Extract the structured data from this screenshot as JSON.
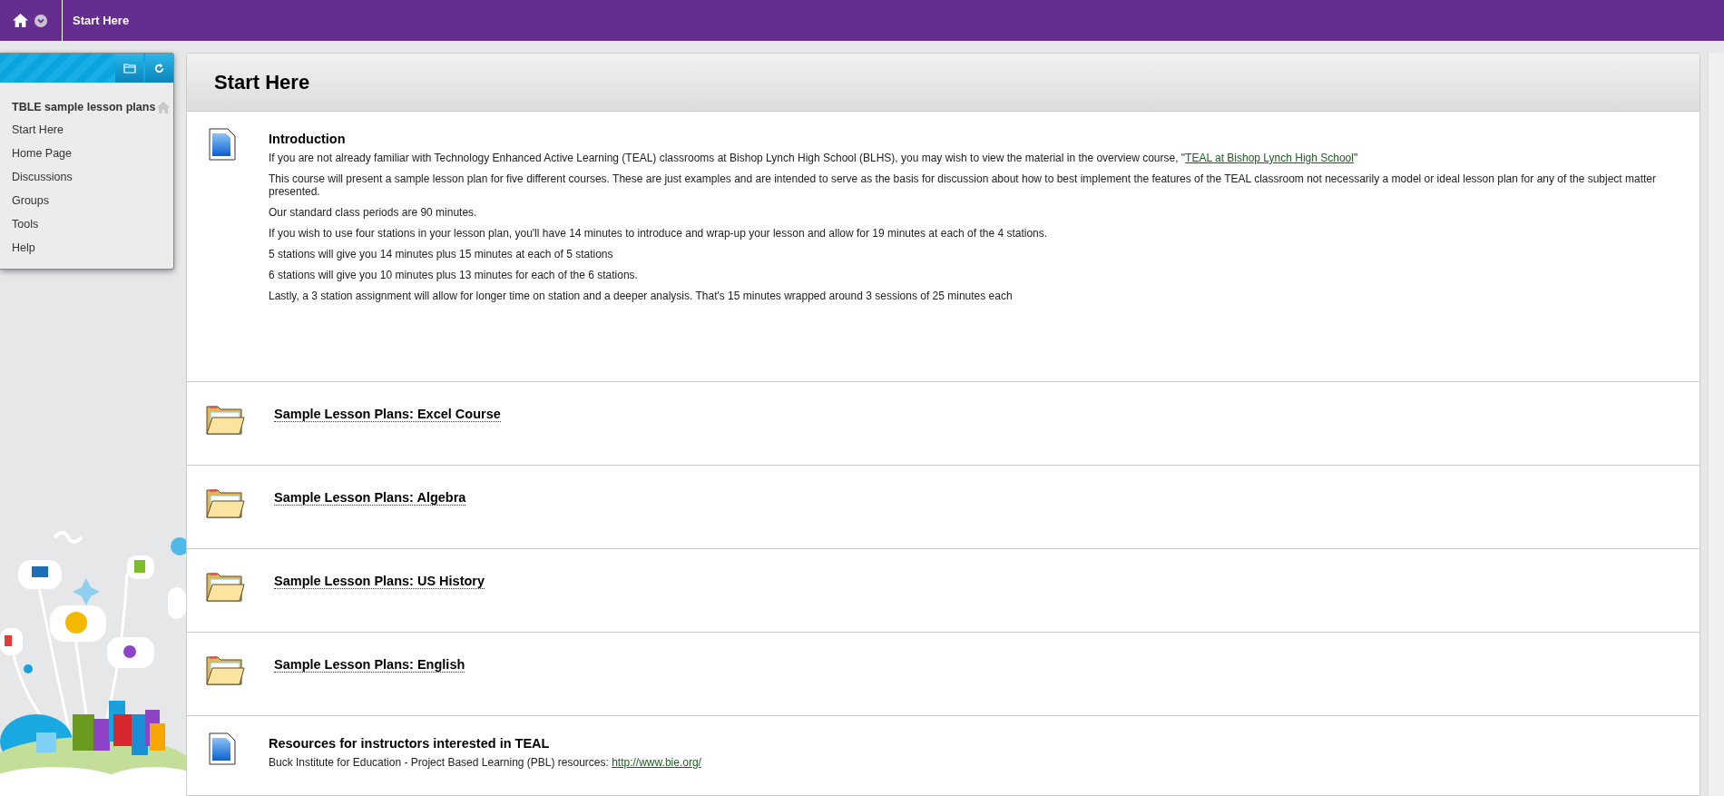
{
  "top_bar": {
    "title": "Start Here"
  },
  "sidebar": {
    "course_title": "TBLE sample lesson plans",
    "items": [
      {
        "label": "Start Here"
      },
      {
        "label": "Home Page"
      },
      {
        "label": "Discussions"
      },
      {
        "label": "Groups"
      },
      {
        "label": "Tools"
      },
      {
        "label": "Help"
      }
    ]
  },
  "content": {
    "title": "Start Here",
    "items": [
      {
        "kind": "document",
        "title": "Introduction",
        "paragraphs": [
          {
            "text": "If you are not already familiar with Technology Enhanced Active Learning (TEAL) classrooms at Bishop Lynch High School (BLHS), you may wish to view the material in the overview course, \"",
            "link": "TEAL at Bishop Lynch High School",
            "after": "\""
          },
          {
            "text": "This course will present a sample lesson plan for five different courses.  These are just examples and are intended to serve as the basis for discussion about how to best implement the features of the TEAL classroom not necessarily a model or ideal lesson plan for any of the subject matter presented."
          },
          {
            "text": "Our standard class periods are 90 minutes."
          },
          {
            "text": "If you wish to use four stations in your lesson plan, you'll have 14 minutes to introduce and wrap-up your lesson and allow for 19 minutes at each of the 4 stations."
          },
          {
            "text": "5 stations will give you 14 minutes plus 15 minutes at each of 5 stations"
          },
          {
            "text": "6 stations will give you 10 minutes plus 13 minutes for each of the 6 stations."
          },
          {
            "text": "Lastly, a 3 station assignment will allow for longer time on station and a deeper analysis.  That's 15 minutes wrapped around 3 sessions of 25 minutes each"
          }
        ]
      },
      {
        "kind": "folder",
        "title": "Sample Lesson Plans: Excel Course"
      },
      {
        "kind": "folder",
        "title": "Sample Lesson Plans: Algebra"
      },
      {
        "kind": "folder",
        "title": "Sample Lesson Plans: US History"
      },
      {
        "kind": "folder",
        "title": "Sample Lesson Plans: English"
      },
      {
        "kind": "document",
        "title": "Resources for instructors interested in TEAL",
        "paragraphs": [
          {
            "text": "Buck Institute for Education - Project Based Learning (PBL) resources:  ",
            "link": "http://www.bie.org/"
          }
        ]
      }
    ]
  }
}
